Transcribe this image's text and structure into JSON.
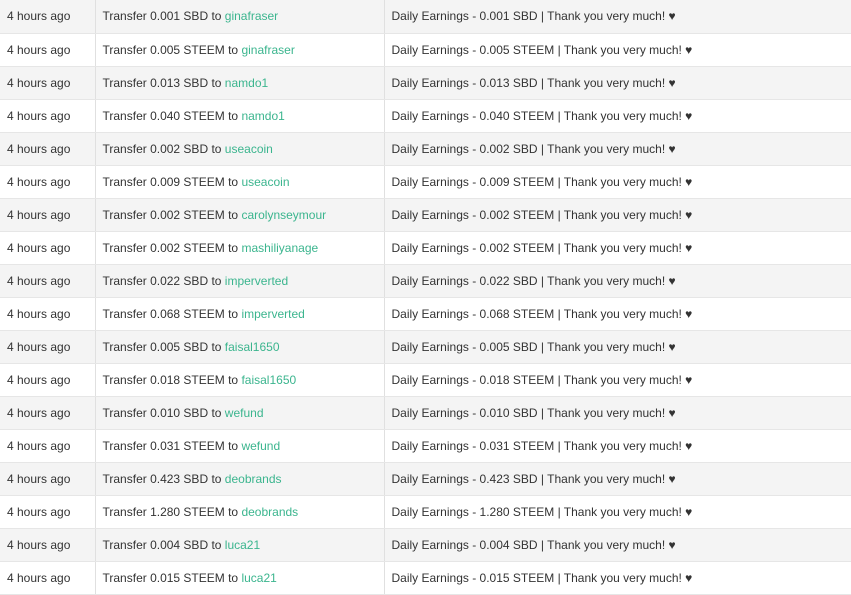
{
  "transactions": [
    {
      "time": "4 hours ago",
      "prefix": "Transfer 0.001 SBD to",
      "recipient": "ginafraser",
      "memo": "Daily Earnings - 0.001 SBD | Thank you very much! ♥"
    },
    {
      "time": "4 hours ago",
      "prefix": "Transfer 0.005 STEEM to",
      "recipient": "ginafraser",
      "memo": "Daily Earnings - 0.005 STEEM | Thank you very much! ♥"
    },
    {
      "time": "4 hours ago",
      "prefix": "Transfer 0.013 SBD to",
      "recipient": "namdo1",
      "memo": "Daily Earnings - 0.013 SBD | Thank you very much! ♥"
    },
    {
      "time": "4 hours ago",
      "prefix": "Transfer 0.040 STEEM to",
      "recipient": "namdo1",
      "memo": "Daily Earnings - 0.040 STEEM | Thank you very much! ♥"
    },
    {
      "time": "4 hours ago",
      "prefix": "Transfer 0.002 SBD to",
      "recipient": "useacoin",
      "memo": "Daily Earnings - 0.002 SBD | Thank you very much! ♥"
    },
    {
      "time": "4 hours ago",
      "prefix": "Transfer 0.009 STEEM to",
      "recipient": "useacoin",
      "memo": "Daily Earnings - 0.009 STEEM | Thank you very much! ♥"
    },
    {
      "time": "4 hours ago",
      "prefix": "Transfer 0.002 STEEM to",
      "recipient": "carolynseymour",
      "memo": "Daily Earnings - 0.002 STEEM | Thank you very much! ♥"
    },
    {
      "time": "4 hours ago",
      "prefix": "Transfer 0.002 STEEM to",
      "recipient": "mashiliyanage",
      "memo": "Daily Earnings - 0.002 STEEM | Thank you very much! ♥"
    },
    {
      "time": "4 hours ago",
      "prefix": "Transfer 0.022 SBD to",
      "recipient": "imperverted",
      "memo": "Daily Earnings - 0.022 SBD | Thank you very much! ♥"
    },
    {
      "time": "4 hours ago",
      "prefix": "Transfer 0.068 STEEM to",
      "recipient": "imperverted",
      "memo": "Daily Earnings - 0.068 STEEM | Thank you very much! ♥"
    },
    {
      "time": "4 hours ago",
      "prefix": "Transfer 0.005 SBD to",
      "recipient": "faisal1650",
      "memo": "Daily Earnings - 0.005 SBD | Thank you very much! ♥"
    },
    {
      "time": "4 hours ago",
      "prefix": "Transfer 0.018 STEEM to",
      "recipient": "faisal1650",
      "memo": "Daily Earnings - 0.018 STEEM | Thank you very much! ♥"
    },
    {
      "time": "4 hours ago",
      "prefix": "Transfer 0.010 SBD to",
      "recipient": "wefund",
      "memo": "Daily Earnings - 0.010 SBD | Thank you very much! ♥"
    },
    {
      "time": "4 hours ago",
      "prefix": "Transfer 0.031 STEEM to",
      "recipient": "wefund",
      "memo": "Daily Earnings - 0.031 STEEM | Thank you very much! ♥"
    },
    {
      "time": "4 hours ago",
      "prefix": "Transfer 0.423 SBD to",
      "recipient": "deobrands",
      "memo": "Daily Earnings - 0.423 SBD | Thank you very much! ♥"
    },
    {
      "time": "4 hours ago",
      "prefix": "Transfer 1.280 STEEM to",
      "recipient": "deobrands",
      "memo": "Daily Earnings - 1.280 STEEM | Thank you very much! ♥"
    },
    {
      "time": "4 hours ago",
      "prefix": "Transfer 0.004 SBD to",
      "recipient": "luca21",
      "memo": "Daily Earnings - 0.004 SBD | Thank you very much! ♥"
    },
    {
      "time": "4 hours ago",
      "prefix": "Transfer 0.015 STEEM to",
      "recipient": "luca21",
      "memo": "Daily Earnings - 0.015 STEEM | Thank you very much! ♥"
    }
  ],
  "colors": {
    "link": "#3bb58e",
    "row_odd": "#f4f4f4",
    "row_even": "#ffffff",
    "text": "#333333"
  }
}
